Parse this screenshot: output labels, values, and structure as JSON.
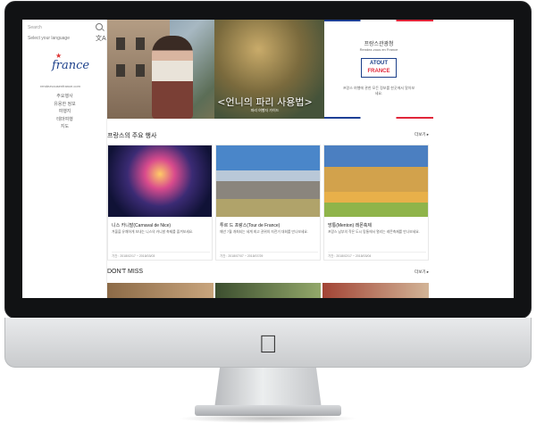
{
  "sidebar": {
    "search_label": "Search",
    "language_label": "Select your language",
    "logo_text": "france",
    "logo_url": "rendezvousenfrance.com",
    "nav": [
      "주요행사",
      "유용한 정보",
      "여행지",
      "테마여행",
      "지도"
    ]
  },
  "hero": {
    "title": "<언니의 파리 사용법>",
    "subtitle": "파리 여행자 가이드"
  },
  "info": {
    "title": "프랑스관광청",
    "subtitle": "Rendez-vous en France",
    "logo_line1": "ATOUT",
    "logo_line2": "FRANCE",
    "desc": "프랑스 여행에 관한 모든 정보를 한곳에서 알아보세요."
  },
  "section_events": {
    "title": "프랑스의 주요 행사",
    "more": "더보기 ▸"
  },
  "cards": [
    {
      "title": "니스 카니발(Carnaval de Nice)",
      "desc": "겨울을 유쾌하게 보내는 니스의 카니발 축제를 즐겨보세요.",
      "date": "기간 : 2018/02/17 ~ 2018/03/03"
    },
    {
      "title": "투르 드 프랑스(Tour de France)",
      "desc": "매년 7월 개최되는 세계 최고 권위의 자전거 대회를 만나보세요.",
      "date": "기간 : 2018/07/07 ~ 2018/07/29"
    },
    {
      "title": "망통(Menton) 레몬축제",
      "desc": "프랑스 남부의 작은 도시 망통에서 열리는 레몬축제를 만나보세요.",
      "date": "기간 : 2018/02/17 ~ 2018/03/04"
    }
  ],
  "section_dontmiss": {
    "title": "DON'T MISS",
    "more": "더보기 ▸"
  },
  "colors": {
    "flag_blue": "#1d3f95",
    "flag_red": "#e1263a",
    "bezel": "#111214"
  },
  "icons": {
    "search": "search-icon",
    "translate": "translate-icon",
    "apple": "apple-logo"
  }
}
